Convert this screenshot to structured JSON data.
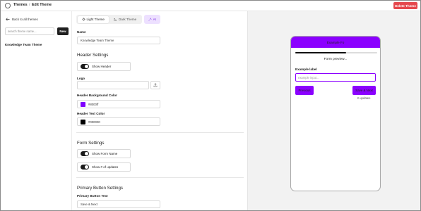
{
  "topbar": {
    "crumb_themes": "Themes",
    "crumb_sep": "/",
    "crumb_edit": "Edit Theme",
    "delete_label": "Delete Theme"
  },
  "sidebar": {
    "back_label": "Back to all themes",
    "search_placeholder": "search theme name...",
    "new_label": "New",
    "themes": [
      "Knowledge Team Theme"
    ]
  },
  "editor": {
    "tabs": {
      "light": "Light Theme",
      "dark": "Dark Theme",
      "ai": "AI"
    },
    "name_label": "Name",
    "name_value": "Knowledge Team Theme",
    "header_section": "Header Settings",
    "show_header": "Show Header",
    "logo_label": "Logo",
    "header_bg_label": "Header Background Color",
    "header_bg_value": "#8000ff",
    "header_text_label": "Header Text Color",
    "header_text_value": "#000000",
    "form_section": "Form Settings",
    "show_form_name": "Show Form Name",
    "show_updates": "Show # of updates",
    "primary_section": "Primary Button Settings",
    "primary_text_label": "Primary Button Text",
    "primary_text_value": "Save & Next"
  },
  "colors": {
    "accent": "#8b00ff",
    "header_text": "#000000",
    "delete": "#e5484d"
  },
  "preview": {
    "header_title": "Example Fo",
    "progress": 0.62,
    "form_preview_text": "Form preview...",
    "example_label": "Example label",
    "input_placeholder": "example input...",
    "previous_label": "Previous",
    "next_label": "Save & Next",
    "updates_text": "2 updates"
  }
}
